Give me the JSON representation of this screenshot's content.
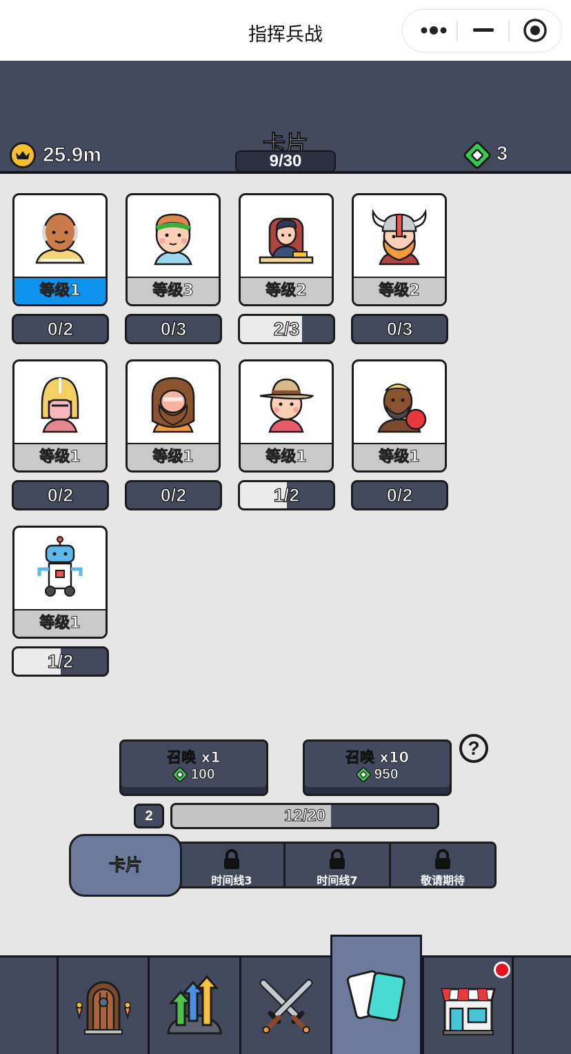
{
  "window": {
    "title": "指挥兵战"
  },
  "header": {
    "coins": "25.9m",
    "title": "卡片",
    "card_count": "9/30",
    "gems": "3"
  },
  "cards": [
    {
      "name": "monk",
      "level": "等级1",
      "progress": "0/2",
      "fill": 0,
      "active": true
    },
    {
      "name": "laurel-greek",
      "level": "等级3",
      "progress": "0/3",
      "fill": 0
    },
    {
      "name": "businessman",
      "level": "等级2",
      "progress": "2/3",
      "fill": 0.667
    },
    {
      "name": "viking",
      "level": "等级2",
      "progress": "0/3",
      "fill": 0
    },
    {
      "name": "spartan-helmet",
      "level": "等级1",
      "progress": "0/2",
      "fill": 0
    },
    {
      "name": "caveman",
      "level": "等级1",
      "progress": "0/2",
      "fill": 0
    },
    {
      "name": "cowboy",
      "level": "等级1",
      "progress": "1/2",
      "fill": 0.5
    },
    {
      "name": "boxer",
      "level": "等级1",
      "progress": "0/2",
      "fill": 0
    },
    {
      "name": "robot",
      "level": "等级1",
      "progress": "1/2",
      "fill": 0.5
    }
  ],
  "summon": {
    "single": {
      "label": "召唤 x1",
      "cost": "100"
    },
    "multi": {
      "label": "召唤 x10",
      "cost": "950"
    },
    "help": "?",
    "level": "2",
    "progress": "12/20",
    "progress_fill": 0.6
  },
  "tabs": {
    "active": "卡片",
    "items": [
      "时间线3",
      "时间线7",
      "敬请期待"
    ]
  },
  "bottom_nav": {
    "items": [
      "door-icon",
      "upgrade-arrows-icon",
      "crossed-swords-icon",
      "cards-icon",
      "shop-icon"
    ],
    "active": "cards-icon"
  },
  "colors": {
    "header_bg": "#434a5e",
    "active_level": "#0e93ee",
    "gem_green": "#39c94e",
    "coin_gold": "#f7c02b",
    "active_tab": "#6c7b9c"
  }
}
